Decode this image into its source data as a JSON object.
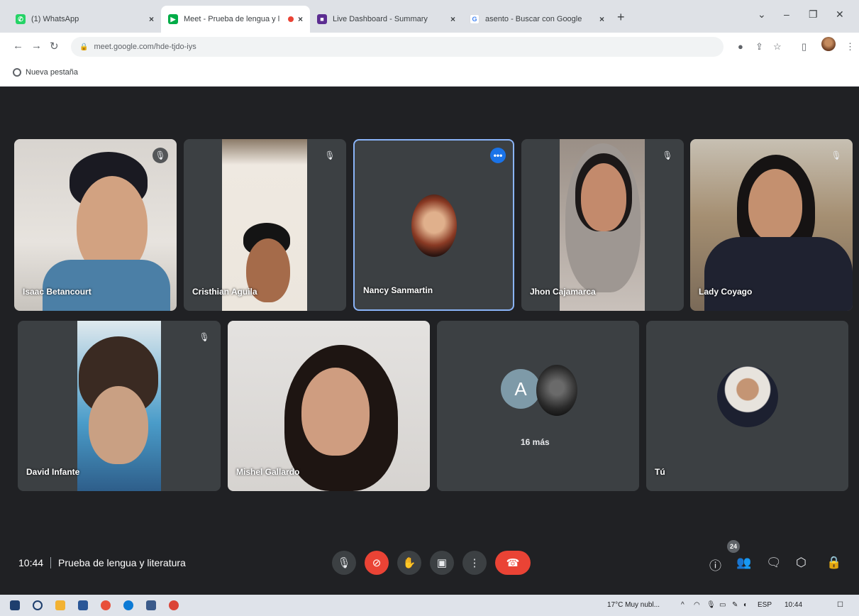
{
  "browser": {
    "tabs": [
      {
        "title": "(1) WhatsApp",
        "color": "#25d366",
        "glyph": "✆"
      },
      {
        "title": "Meet - Prueba de lengua y l",
        "color": "#00ac47",
        "glyph": "▶"
      },
      {
        "title": "Live Dashboard - Summary",
        "color": "#5c2d91",
        "glyph": "■"
      },
      {
        "title": "asento - Buscar con Google",
        "color": "#4285f4",
        "glyph": "G"
      }
    ],
    "url": "meet.google.com/hde-tjdo-iys",
    "bookmark": "Nueva pestaña"
  },
  "tiles": [
    {
      "name": "Isaac Betancourt"
    },
    {
      "name": "Cristhian Aguila"
    },
    {
      "name": "Nancy Sanmartin"
    },
    {
      "name": "Jhon Cajamarca"
    },
    {
      "name": "Lady Coyago"
    },
    {
      "name": "David Infante"
    },
    {
      "name": "Mishel Gallardo"
    },
    {
      "name": ""
    },
    {
      "name": "Tú"
    }
  ],
  "more": {
    "letter": "A",
    "label": "16 más"
  },
  "meeting": {
    "time": "10:44",
    "title": "Prueba de lengua y literatura",
    "participants": "24"
  },
  "taskbar": {
    "weather": "17°C Muy nubl...",
    "lang": "ESP",
    "clock": "10:44"
  },
  "colors": {
    "meet_bg": "#202124",
    "tile_bg": "#3c4043",
    "hangup": "#ea4335",
    "highlight": "#8ab4f8"
  }
}
